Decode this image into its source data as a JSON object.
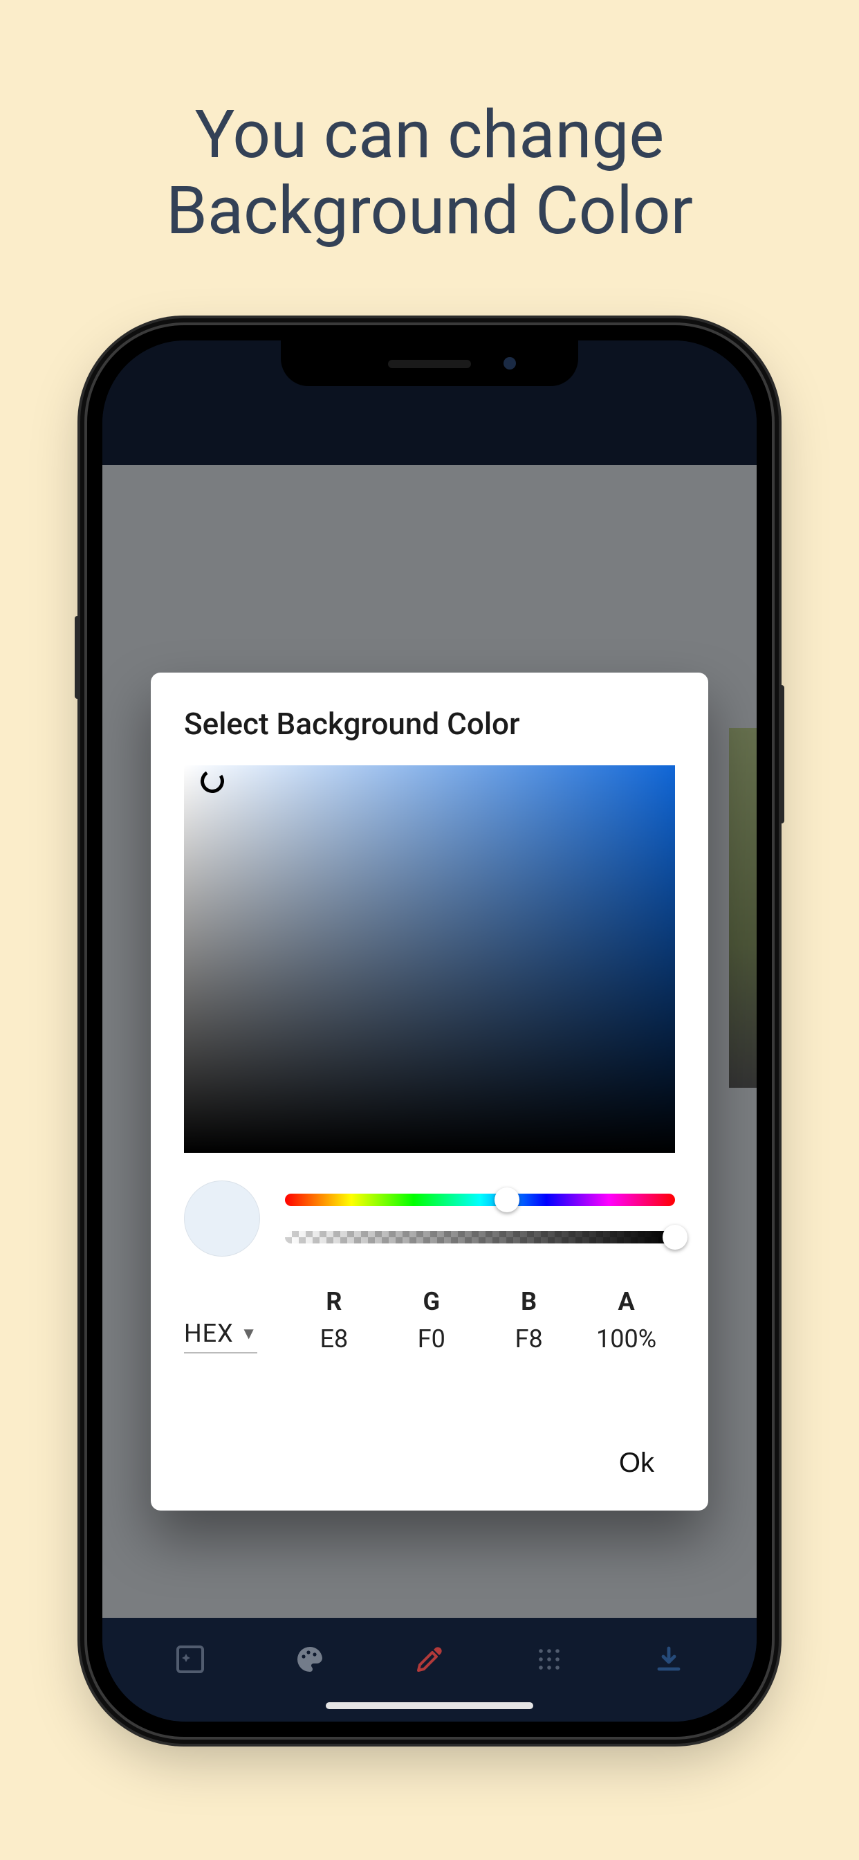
{
  "headline": {
    "line1": "You can change",
    "line2": "Background Color"
  },
  "modal": {
    "title": "Select Background Color",
    "format_label": "HEX",
    "rgba_headers": {
      "r": "R",
      "g": "G",
      "b": "B",
      "a": "A"
    },
    "rgba_values": {
      "r": "E8",
      "g": "F0",
      "b": "F8",
      "a": "100%"
    },
    "swatch_color": "#E8F0F8",
    "ok_label": "Ok"
  },
  "tabs": {
    "effects": "effects",
    "palette": "palette",
    "eyedropper": "eyedropper",
    "grid": "grid",
    "download": "download"
  }
}
